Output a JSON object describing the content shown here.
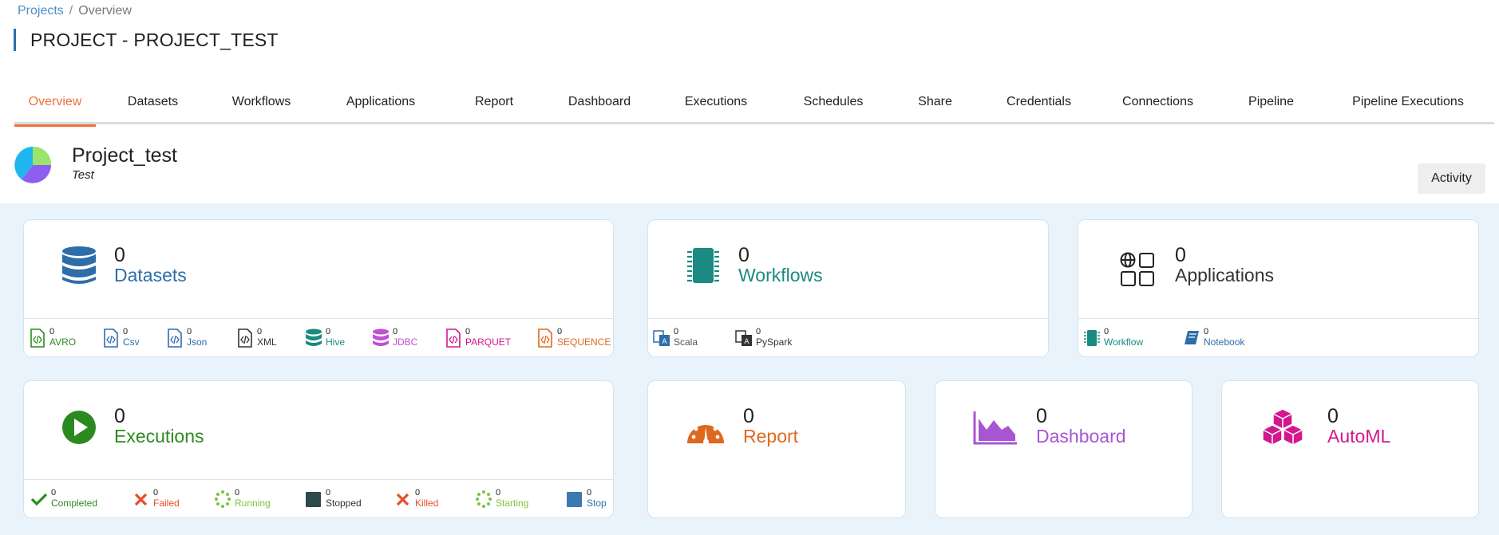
{
  "breadcrumb": {
    "projects": "Projects",
    "separator": "/",
    "current": "Overview"
  },
  "page_title": "PROJECT - PROJECT_TEST",
  "tabs": [
    "Overview",
    "Datasets",
    "Workflows",
    "Applications",
    "Report",
    "Dashboard",
    "Executions",
    "Schedules",
    "Share",
    "Credentials",
    "Connections",
    "Pipeline",
    "Pipeline Executions"
  ],
  "active_tab": "Overview",
  "project": {
    "name": "Project_test",
    "description": "Test"
  },
  "activity_label": "Activity",
  "colors": {
    "accent": "#f0703a",
    "datasets": "#2d6ea8",
    "workflows": "#1a8a82",
    "applications": "#333333",
    "executions": "#2b8a1f",
    "report": "#e0681e",
    "dashboard": "#a855d4",
    "automl": "#d3178e"
  },
  "cards": {
    "datasets": {
      "count": "0",
      "label": "Datasets",
      "items": [
        {
          "count": "0",
          "label": "AVRO"
        },
        {
          "count": "0",
          "label": "Csv"
        },
        {
          "count": "0",
          "label": "Json"
        },
        {
          "count": "0",
          "label": "XML"
        },
        {
          "count": "0",
          "label": "Hive"
        },
        {
          "count": "0",
          "label": "JDBC"
        },
        {
          "count": "0",
          "label": "PARQUET"
        },
        {
          "count": "0",
          "label": "SEQUENCE"
        }
      ]
    },
    "workflows": {
      "count": "0",
      "label": "Workflows",
      "items": [
        {
          "count": "0",
          "label": "Scala"
        },
        {
          "count": "0",
          "label": "PySpark"
        }
      ]
    },
    "applications": {
      "count": "0",
      "label": "Applications",
      "items": [
        {
          "count": "0",
          "label": "Workflow"
        },
        {
          "count": "0",
          "label": "Notebook"
        }
      ]
    },
    "executions": {
      "count": "0",
      "label": "Executions",
      "items": [
        {
          "count": "0",
          "label": "Completed"
        },
        {
          "count": "0",
          "label": "Failed"
        },
        {
          "count": "0",
          "label": "Running"
        },
        {
          "count": "0",
          "label": "Stopped"
        },
        {
          "count": "0",
          "label": "Killed"
        },
        {
          "count": "0",
          "label": "Starting"
        },
        {
          "count": "0",
          "label": "Stop"
        }
      ]
    },
    "report": {
      "count": "0",
      "label": "Report"
    },
    "dashboard": {
      "count": "0",
      "label": "Dashboard"
    },
    "automl": {
      "count": "0",
      "label": "AutoML"
    }
  }
}
